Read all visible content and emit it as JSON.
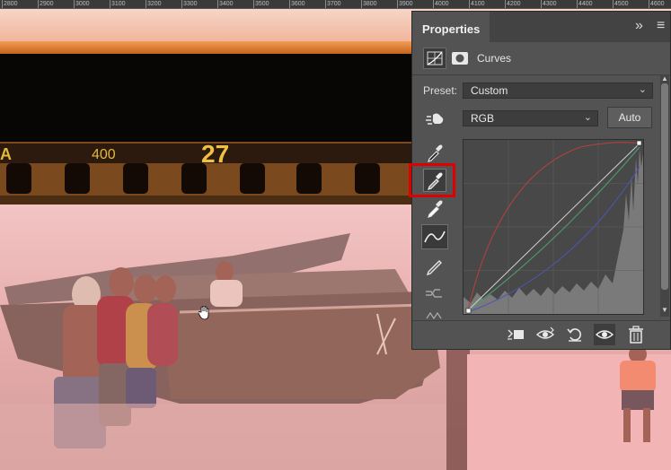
{
  "ruler": {
    "labels": [
      "2800",
      "2900",
      "3000",
      "3100",
      "3200",
      "3300",
      "3400",
      "3500",
      "3600",
      "3700",
      "3800",
      "3900",
      "4000",
      "4100",
      "4200",
      "4300",
      "4400",
      "4500",
      "4600",
      "4700"
    ]
  },
  "photo": {
    "film_edge_texts": [
      "A",
      "400",
      "27"
    ]
  },
  "panel": {
    "title": "Properties",
    "collapse_glyph": "»",
    "menu_glyph": "≡",
    "adjustment_name": "Curves",
    "preset_label": "Preset:",
    "preset_value": "Custom",
    "channel_value": "RGB",
    "auto_label": "Auto"
  },
  "colors": {
    "highlight": "#e00000",
    "curve_red": "#b04040",
    "curve_green": "#4f9a70",
    "curve_blue": "#4b56b0"
  },
  "icons": [
    "curves-grid-icon",
    "mask-icon",
    "on-image-adjust-icon",
    "eyedropper-black-icon",
    "eyedropper-gray-icon",
    "eyedropper-white-icon",
    "curve-point-icon",
    "pencil-icon",
    "smooth-icon",
    "clip-warning-icon",
    "clip-to-layer-icon",
    "view-previous-icon",
    "reset-icon",
    "visibility-icon",
    "trash-icon",
    "hand-cursor-icon"
  ]
}
